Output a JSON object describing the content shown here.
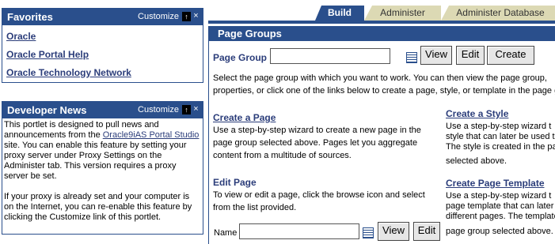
{
  "favorites": {
    "title": "Favorites",
    "customize": "Customize",
    "links": [
      "Oracle",
      "Oracle Portal Help",
      "Oracle Technology Network"
    ]
  },
  "developer_news": {
    "title": "Developer News",
    "customize": "Customize",
    "para1_a": "This portlet is designed to pull news and announcements from the ",
    "para1_link": "Oracle9iAS Portal Studio",
    "para1_b": " site. You can enable this feature by setting your proxy server under Proxy Settings on the Administer tab. This version requires a proxy server be set.",
    "para2": "If your proxy is already set and your computer is on the Internet, you can re-enable this feature by clicking the Customize link of this portlet."
  },
  "tabs": [
    "Build",
    "Administer",
    "Administer Database"
  ],
  "page_groups": {
    "title": "Page Groups",
    "page_group_label": "Page Group",
    "page_group_value": "",
    "buttons": [
      "View",
      "Edit",
      "Create"
    ],
    "instructions_1": "Select the page group with which you want to work. You can then view the page group, ",
    "instructions_2": "properties, or click one of the links below to create a page, style, or template in the page g",
    "create_page": {
      "link": "Create a Page",
      "lines": [
        "Use a step-by-step wizard to create a new page in the",
        "page group selected above. Pages let you aggregate",
        "content from a multitude of sources."
      ]
    },
    "edit_page": {
      "label": "Edit Page",
      "lines": [
        "To view or edit a page, click the browse icon and select",
        "from the list provided."
      ],
      "name_label": "Name",
      "name_value": "",
      "buttons": [
        "View",
        "Edit"
      ]
    },
    "create_style": {
      "link": "Create a Style",
      "lines": [
        "Use a step-by-step wizard t",
        "style that can later be used t",
        "The style is created in the pa",
        "selected above."
      ]
    },
    "create_template": {
      "link": "Create Page Template",
      "lines": [
        "Use a step-by-step wizard t",
        "page template that can later l",
        "different pages. The template",
        "page group selected above."
      ]
    }
  }
}
